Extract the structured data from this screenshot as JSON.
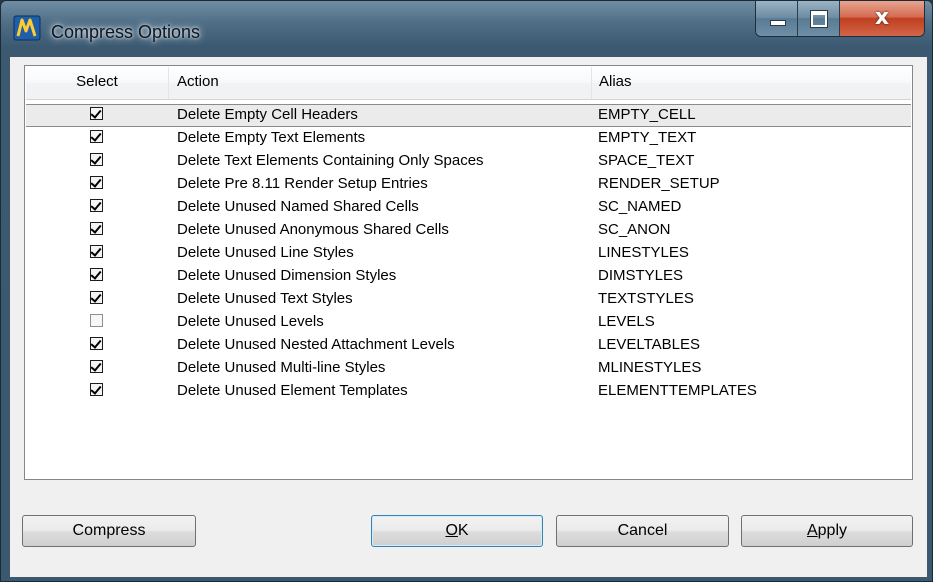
{
  "window": {
    "title": "Compress Options",
    "close_glyph": "x",
    "icons": {
      "app": "app-logo-icon",
      "minimize": "minimize-icon",
      "maximize": "maximize-icon",
      "close": "close-icon"
    }
  },
  "table": {
    "headers": {
      "select": "Select",
      "action": "Action",
      "alias": "Alias"
    },
    "rows": [
      {
        "checked": true,
        "action": "Delete Empty Cell Headers",
        "alias": "EMPTY_CELL",
        "selected": true
      },
      {
        "checked": true,
        "action": "Delete Empty Text Elements",
        "alias": "EMPTY_TEXT"
      },
      {
        "checked": true,
        "action": "Delete Text Elements Containing Only Spaces",
        "alias": "SPACE_TEXT"
      },
      {
        "checked": true,
        "action": "Delete Pre 8.11 Render Setup Entries",
        "alias": "RENDER_SETUP"
      },
      {
        "checked": true,
        "action": "Delete Unused Named Shared Cells",
        "alias": "SC_NAMED"
      },
      {
        "checked": true,
        "action": "Delete Unused Anonymous Shared Cells",
        "alias": "SC_ANON"
      },
      {
        "checked": true,
        "action": "Delete Unused Line Styles",
        "alias": "LINESTYLES"
      },
      {
        "checked": true,
        "action": "Delete Unused Dimension Styles",
        "alias": "DIMSTYLES"
      },
      {
        "checked": true,
        "action": "Delete Unused Text Styles",
        "alias": "TEXTSTYLES"
      },
      {
        "checked": false,
        "action": "Delete Unused Levels",
        "alias": "LEVELS"
      },
      {
        "checked": true,
        "action": "Delete Unused Nested Attachment Levels",
        "alias": "LEVELTABLES"
      },
      {
        "checked": true,
        "action": "Delete Unused Multi-line Styles",
        "alias": "MLINESTYLES"
      },
      {
        "checked": true,
        "action": "Delete Unused Element Templates",
        "alias": "ELEMENTTEMPLATES"
      }
    ]
  },
  "buttons": {
    "compress": "Compress",
    "ok": {
      "mnemonic": "O",
      "rest": "K"
    },
    "cancel": "Cancel",
    "apply": {
      "mnemonic": "A",
      "rest": "pply"
    }
  },
  "colors": {
    "titlebar": "#4f6e86",
    "client_bg": "#f0f0f0",
    "close_button": "#c13f1f",
    "default_button_border": "#3c7fb1"
  }
}
